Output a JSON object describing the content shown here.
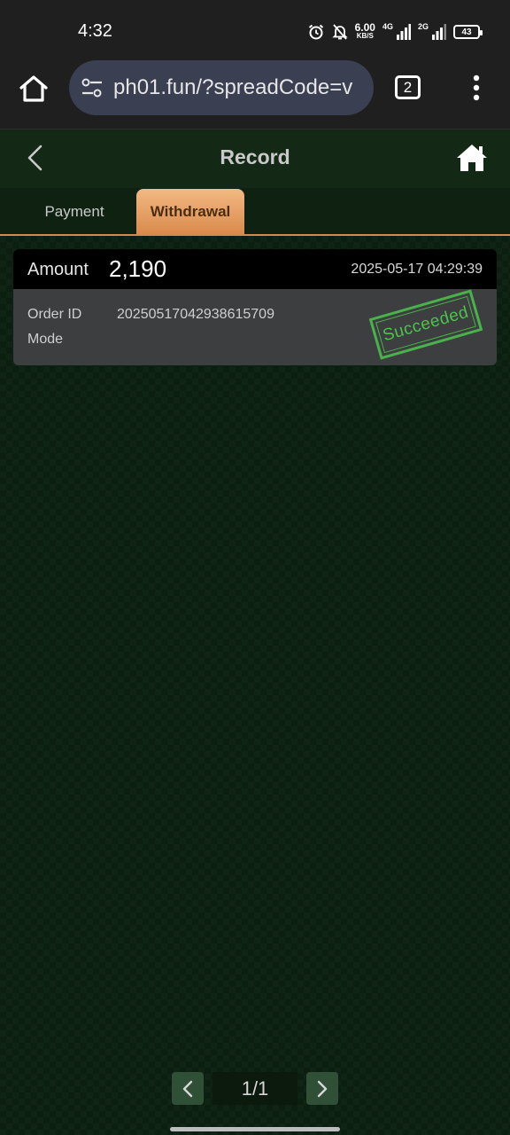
{
  "status_bar": {
    "time": "4:32",
    "net_speed_value": "6.00",
    "net_speed_unit": "KB/S",
    "signal_1_label": "4G",
    "signal_2_label": "2G",
    "battery": "43"
  },
  "browser": {
    "url": "ph01.fun/?spreadCode=v",
    "tab_count": "2"
  },
  "header": {
    "title": "Record"
  },
  "tabs": [
    {
      "label": "Payment",
      "active": false
    },
    {
      "label": "Withdrawal",
      "active": true
    }
  ],
  "record": {
    "amount_label": "Amount",
    "amount": "2,190",
    "datetime": "2025-05-17 04:29:39",
    "order_id_label": "Order ID",
    "order_id": "20250517042938615709",
    "mode_label": "Mode",
    "status": "Succeeded"
  },
  "pagination": {
    "indicator": "1/1"
  },
  "colors": {
    "accent_tab": "#d98a4c",
    "stamp_green": "#49b24a",
    "background": "#0f2414"
  }
}
